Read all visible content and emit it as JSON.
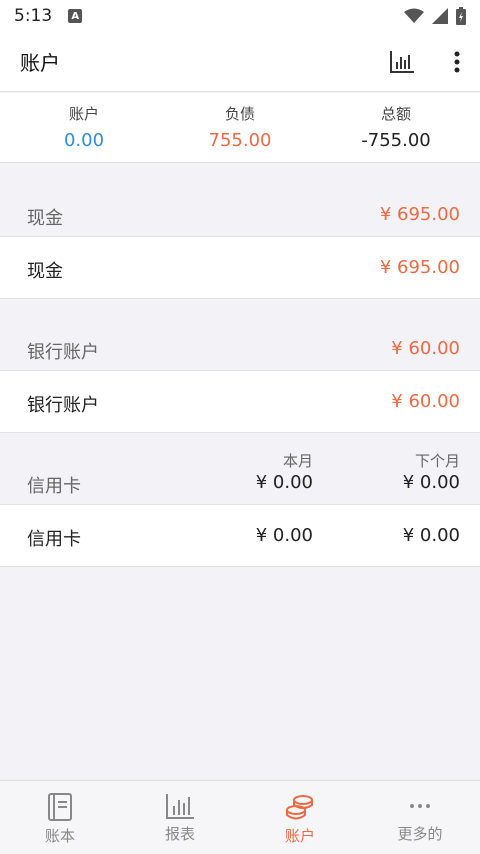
{
  "status": {
    "time": "5:13",
    "indicator": "A"
  },
  "app_bar": {
    "title": "账户"
  },
  "summary": {
    "accounts_label": "账户",
    "accounts_value": "0.00",
    "debt_label": "负债",
    "debt_value": "755.00",
    "total_label": "总额",
    "total_value": "-755.00"
  },
  "cash": {
    "header_label": "现金",
    "header_amount": "¥ 695.00",
    "item_label": "现金",
    "item_amount": "¥ 695.00"
  },
  "bank": {
    "header_label": "银行账户",
    "header_amount": "¥ 60.00",
    "item_label": "银行账户",
    "item_amount": "¥ 60.00"
  },
  "credit": {
    "header_label": "信用卡",
    "this_month_label": "本月",
    "next_month_label": "下个月",
    "header_this_month": "¥ 0.00",
    "header_next_month": "¥ 0.00",
    "item_label": "信用卡",
    "item_this_month": "¥ 0.00",
    "item_next_month": "¥ 0.00"
  },
  "nav": {
    "items": [
      {
        "label": "账本",
        "icon": "book-icon"
      },
      {
        "label": "报表",
        "icon": "chart-icon"
      },
      {
        "label": "账户",
        "icon": "coins-icon"
      },
      {
        "label": "更多的",
        "icon": "more-icon"
      }
    ],
    "active": "账户"
  },
  "colors": {
    "accent": "#ec6a43",
    "blue": "#2d8ee0"
  }
}
